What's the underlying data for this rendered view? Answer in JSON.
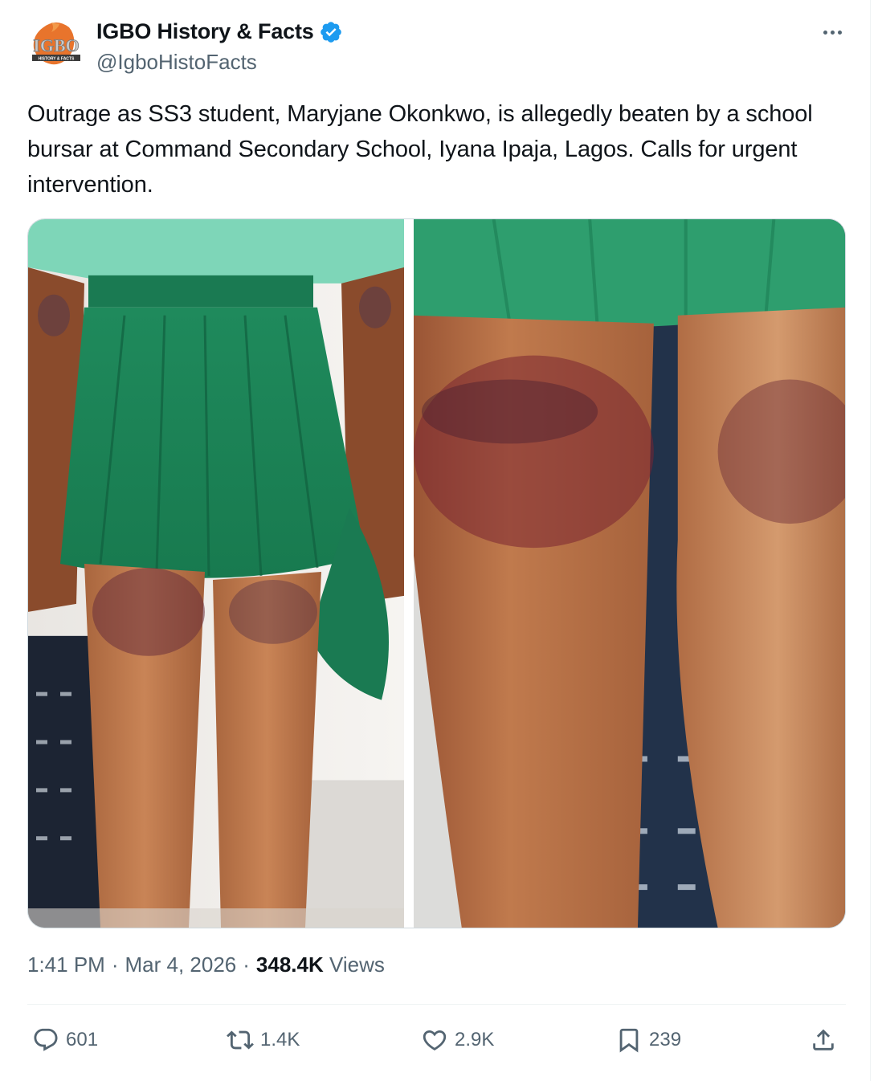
{
  "author": {
    "display_name": "IGBO History & Facts",
    "handle": "@IgboHistoFacts",
    "logo_text": "IGBO",
    "logo_subtext": "HISTORY & FACTS",
    "verified_color": "#1d9bf0"
  },
  "tweet": {
    "text": "Outrage as SS3 student, Maryjane Okonkwo, is allegedly beaten by a school bursar at Command Secondary School, Iyana Ipaja, Lagos. Calls for urgent intervention."
  },
  "media": {
    "count": 2
  },
  "meta": {
    "time": "1:41 PM",
    "separator": "·",
    "date": "Mar 4, 2026",
    "views_count": "348.4K",
    "views_label": "Views"
  },
  "actions": {
    "replies": "601",
    "reposts": "1.4K",
    "likes": "2.9K",
    "bookmarks": "239"
  },
  "icons": {
    "more": "more-horizontal-icon",
    "reply": "reply-icon",
    "repost": "repost-icon",
    "like": "heart-icon",
    "bookmark": "bookmark-icon",
    "share": "share-icon"
  }
}
